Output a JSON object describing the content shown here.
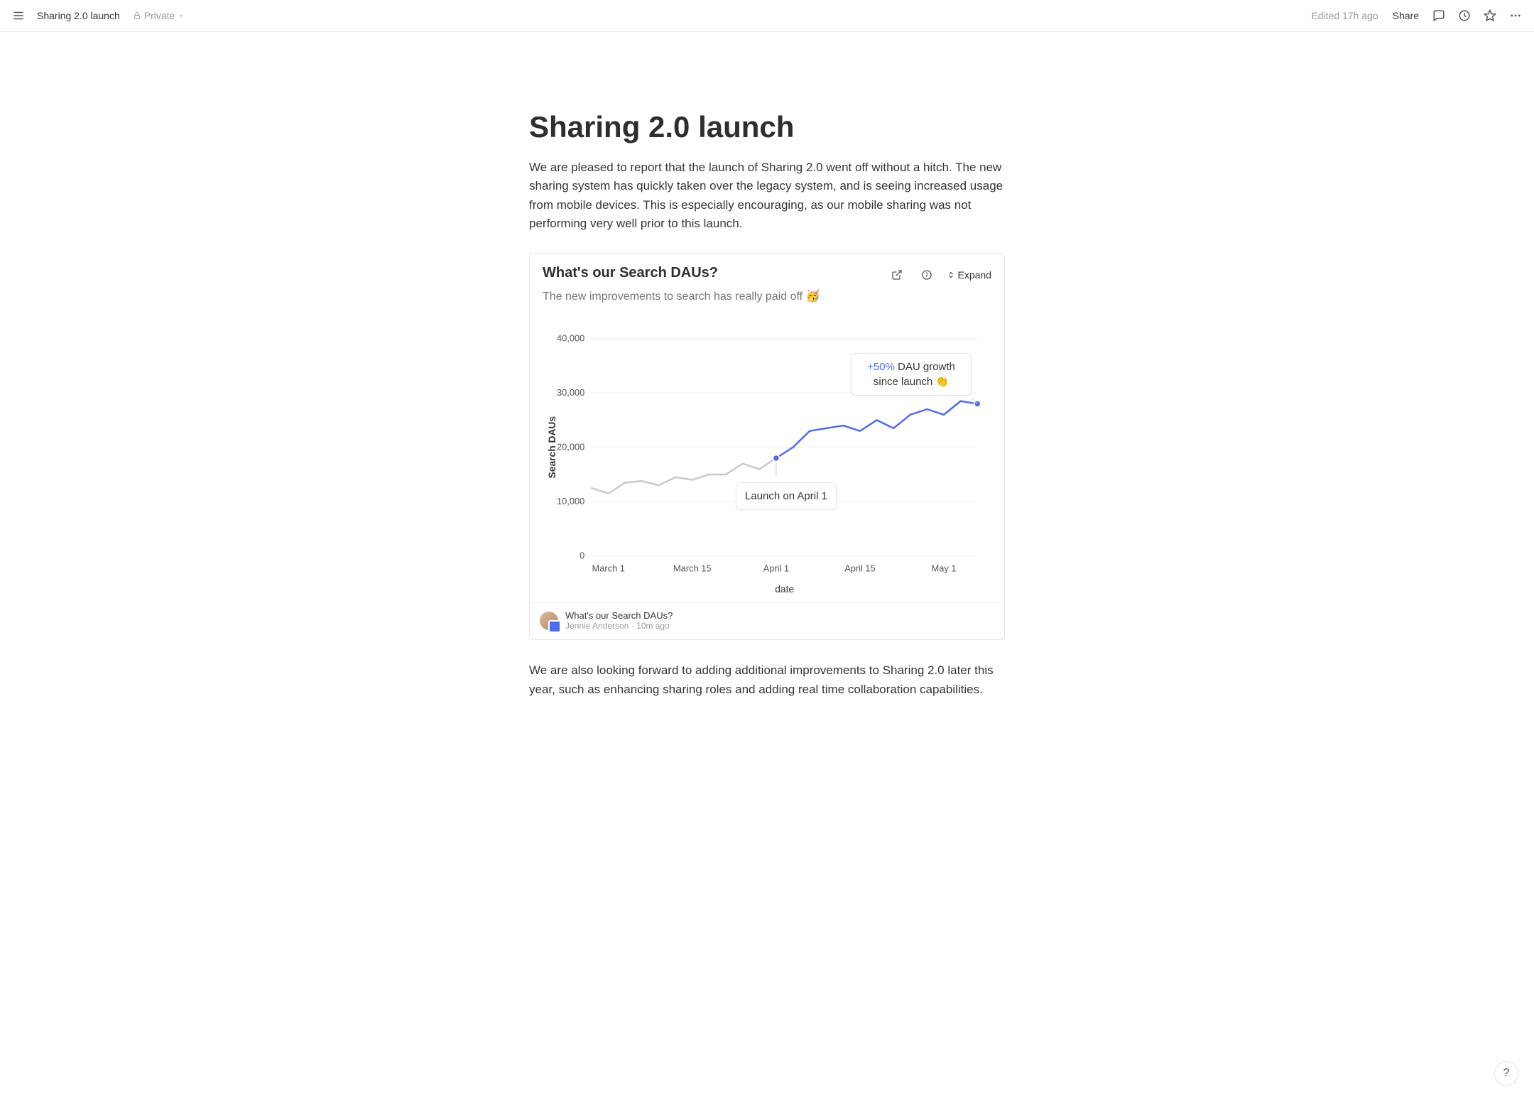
{
  "topbar": {
    "breadcrumb": "Sharing 2.0 launch",
    "privacy": "Private",
    "edited": "Edited 17h ago",
    "share": "Share"
  },
  "page": {
    "title": "Sharing 2.0 launch",
    "intro": "We are pleased to report that the launch of Sharing 2.0 went off without a hitch. The new sharing system has quickly taken over the legacy system, and is seeing increased usage from mobile devices. This is especially encouraging, as our mobile sharing was not performing very well prior to this launch.",
    "outro": "We are also looking forward to adding additional improvements to Sharing 2.0 later this year, such as enhancing sharing roles and adding real time collaboration capabilities."
  },
  "chart_card": {
    "title": "What's our Search DAUs?",
    "subtitle": "The new improvements to search has really paid off 🥳",
    "expand": "Expand",
    "annotation_growth_pct": "+50%",
    "annotation_growth_rest": " DAU growth since launch 👏",
    "annotation_launch": "Launch on April 1",
    "footer_title": "What's our Search DAUs?",
    "footer_author": "Jennie Anderson",
    "footer_time": "10m ago"
  },
  "chart_data": {
    "type": "line",
    "title": "What's our Search DAUs?",
    "xlabel": "date",
    "ylabel": "Search DAUs",
    "ylim": [
      0,
      40000
    ],
    "x_tick_labels": [
      "March 1",
      "March 15",
      "April 1",
      "April 15",
      "May 1"
    ],
    "y_tick_labels": [
      "0",
      "10,000",
      "20,000",
      "30,000",
      "40,000"
    ],
    "series": [
      {
        "name": "pre-launch",
        "color": "#c9c9c7",
        "points": [
          {
            "x": "Feb 26",
            "y": 12500
          },
          {
            "x": "Mar 1",
            "y": 11500
          },
          {
            "x": "Mar 4",
            "y": 13500
          },
          {
            "x": "Mar 7",
            "y": 13800
          },
          {
            "x": "Mar 10",
            "y": 13000
          },
          {
            "x": "Mar 13",
            "y": 14500
          },
          {
            "x": "Mar 16",
            "y": 14000
          },
          {
            "x": "Mar 19",
            "y": 15000
          },
          {
            "x": "Mar 22",
            "y": 15000
          },
          {
            "x": "Mar 25",
            "y": 17000
          },
          {
            "x": "Mar 28",
            "y": 16000
          },
          {
            "x": "Apr 1",
            "y": 18000
          }
        ]
      },
      {
        "name": "post-launch",
        "color": "#4f6bed",
        "points": [
          {
            "x": "Apr 1",
            "y": 18000
          },
          {
            "x": "Apr 4",
            "y": 20000
          },
          {
            "x": "Apr 7",
            "y": 23000
          },
          {
            "x": "Apr 10",
            "y": 23500
          },
          {
            "x": "Apr 13",
            "y": 24000
          },
          {
            "x": "Apr 16",
            "y": 23000
          },
          {
            "x": "Apr 19",
            "y": 25000
          },
          {
            "x": "Apr 22",
            "y": 23500
          },
          {
            "x": "Apr 25",
            "y": 26000
          },
          {
            "x": "Apr 28",
            "y": 27000
          },
          {
            "x": "May 1",
            "y": 26000
          },
          {
            "x": "May 4",
            "y": 28500
          },
          {
            "x": "May 7",
            "y": 28000
          }
        ]
      }
    ],
    "markers": [
      {
        "x": "Apr 1",
        "y": 18000,
        "label": "Launch on April 1"
      },
      {
        "x": "May 7",
        "y": 28000,
        "label": "+50% DAU growth since launch"
      }
    ]
  },
  "help": "?"
}
